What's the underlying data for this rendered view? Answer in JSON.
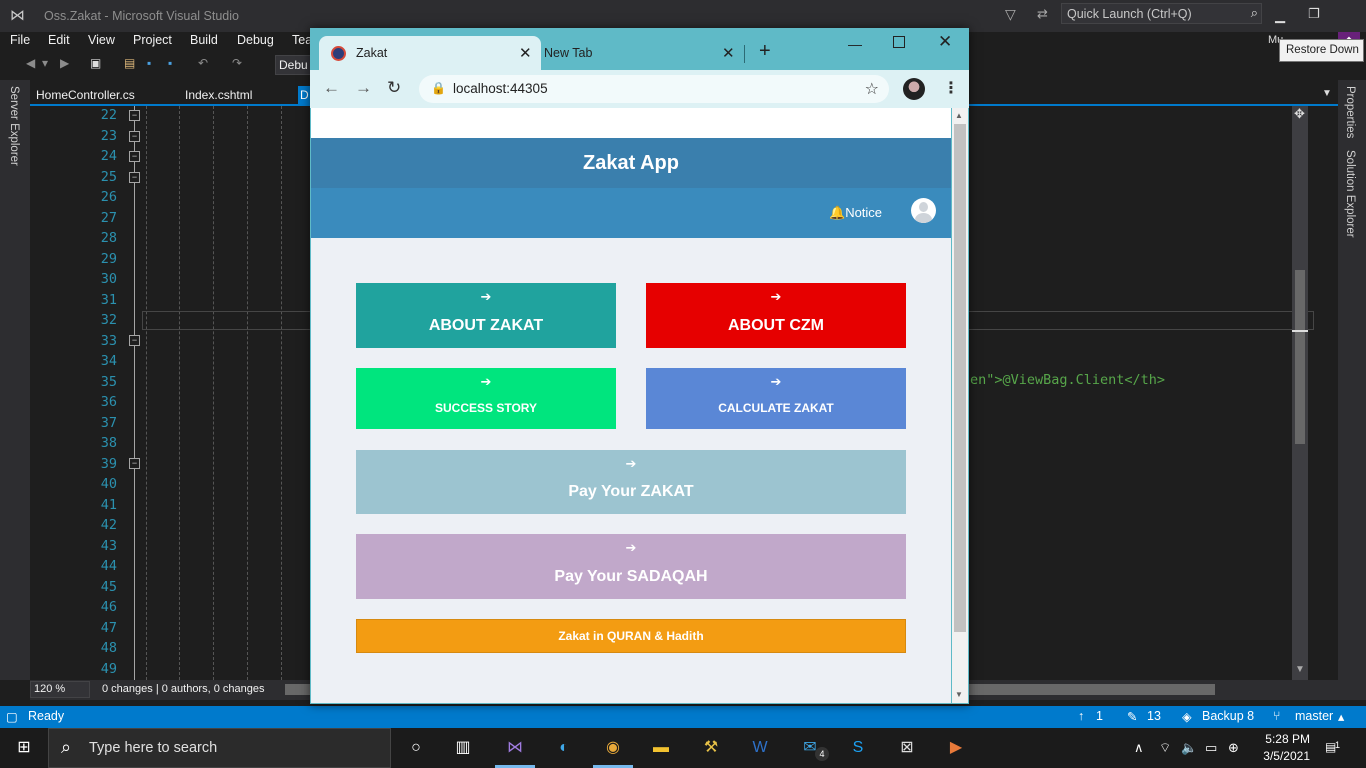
{
  "vs": {
    "title": "Oss.Zakat - Microsoft Visual Studio",
    "quick_launch": "Quick Launch (Ctrl+Q)",
    "user_initials": "Mu",
    "tooltip": "Restore Down",
    "menu": [
      "File",
      "Edit",
      "View",
      "Project",
      "Build",
      "Debug",
      "Tea"
    ],
    "toolbar_config": "Debu",
    "left_panel": "Server Explorer",
    "right_panels": [
      "Properties",
      "Solution Explorer"
    ],
    "tabs": [
      "HomeController.cs",
      "Index.cshtml"
    ],
    "active_tab_stub": "D",
    "line_numbers": [
      "22",
      "23",
      "24",
      "25",
      "26",
      "27",
      "28",
      "29",
      "30",
      "31",
      "32",
      "33",
      "34",
      "35",
      "36",
      "37",
      "38",
      "39",
      "40",
      "41",
      "42",
      "43",
      "44",
      "45",
      "46",
      "47",
      "48",
      "49"
    ],
    "code_fragment": "en\">@ViewBag.Client</th>",
    "zoom": "120 %",
    "changes": "0 changes | 0 authors, 0 changes",
    "status": {
      "ready": "Ready",
      "up_count": "1",
      "edit_count": "13",
      "repo": "Backup 8",
      "branch": "master"
    }
  },
  "taskbar": {
    "search_placeholder": "Type here to search",
    "mail_badge": "4",
    "time": "5:28 PM",
    "date": "3/5/2021",
    "notifications": "1"
  },
  "browser": {
    "tabs": [
      {
        "title": "Zakat"
      },
      {
        "title": "New Tab"
      }
    ],
    "url": "localhost:44305"
  },
  "app": {
    "title": "Zakat App",
    "notice_label": "Notice",
    "tiles": [
      {
        "label": "ABOUT ZAKAT",
        "color": "#20a39e"
      },
      {
        "label": "ABOUT CZM",
        "color": "#e60000"
      },
      {
        "label": "SUCCESS STORY",
        "color": "#00e57e"
      },
      {
        "label": "CALCULATE ZAKAT",
        "color": "#5a87d6"
      },
      {
        "label": "Pay Your ZAKAT",
        "color": "#9cc4d0"
      },
      {
        "label": "Pay Your SADAQAH",
        "color": "#c1a8ca"
      },
      {
        "label": "Zakat in QURAN & Hadith",
        "color": "#f39c12"
      }
    ]
  }
}
